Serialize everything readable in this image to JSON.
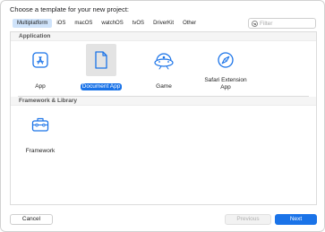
{
  "dialog": {
    "prompt": "Choose a template for your new project:"
  },
  "tabs": [
    {
      "label": "Multiplatform",
      "active": true
    },
    {
      "label": "iOS"
    },
    {
      "label": "macOS"
    },
    {
      "label": "watchOS"
    },
    {
      "label": "tvOS"
    },
    {
      "label": "DriverKit"
    },
    {
      "label": "Other"
    }
  ],
  "filter": {
    "placeholder": "Filter",
    "value": ""
  },
  "sections": {
    "application": {
      "title": "Application",
      "items": [
        {
          "label": "App",
          "icon": "app-store-icon"
        },
        {
          "label": "Document App",
          "icon": "document-icon",
          "selected": true
        },
        {
          "label": "Game",
          "icon": "game-controller-icon"
        },
        {
          "label": "Safari Extension App",
          "icon": "safari-compass-icon"
        }
      ]
    },
    "framework": {
      "title": "Framework & Library",
      "items": [
        {
          "label": "Framework",
          "icon": "toolbox-icon"
        }
      ]
    }
  },
  "buttons": {
    "cancel": "Cancel",
    "previous": "Previous",
    "next": "Next"
  },
  "colors": {
    "accent": "#1a73e8",
    "icon": "#1a73e8",
    "tab_active_bg": "#cfe3fa"
  }
}
